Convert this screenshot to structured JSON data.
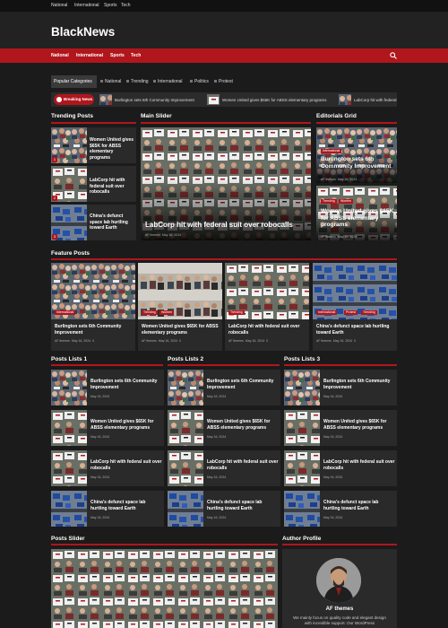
{
  "topbar": [
    "National",
    "International",
    "Sports",
    "Tech"
  ],
  "logo": "BlackNews",
  "nav": [
    "National",
    "International",
    "Sports",
    "Tech"
  ],
  "popular": {
    "label": "Popular Categories",
    "items": [
      "National",
      "Trending",
      "International",
      "Politics",
      "Protest"
    ]
  },
  "ticker": {
    "label": "Breaking News",
    "items": [
      "Burlington sets 6th Community Improvement",
      "Women United gives $65K for ABSS elementary programs",
      "LabCorp hit with federal"
    ]
  },
  "sections": {
    "trending": "Trending Posts",
    "main_slider": "Main Slider",
    "editorials": "Editorials Grid",
    "feature": "Feature Posts",
    "list1": "Posts Lists 1",
    "list2": "Posts Lists 2",
    "list3": "Posts Lists 3",
    "slider": "Posts Slider",
    "author": "Author Profile"
  },
  "posts": [
    {
      "title": "Burlington sets 6th Community Improvement",
      "badges": [
        "International"
      ]
    },
    {
      "title": "Women United gives $65K for ABSS elementary programs",
      "badges": [
        "Trending",
        "Women"
      ]
    },
    {
      "title": "LabCorp hit with federal suit over robocalls",
      "badges": [
        "Trending"
      ]
    },
    {
      "title": "China's defunct space lab hurtling toward Earth",
      "badges": [
        "International",
        "Protest",
        "Trending"
      ]
    }
  ],
  "trending_posts": [
    {
      "num": "1",
      "title": "Women United gives $65K for ABSS elementary programs"
    },
    {
      "num": "2",
      "title": "LabCorp hit with federal suit over robocalls"
    },
    {
      "num": "3",
      "title": "China's defunct space lab hurtling toward Earth"
    }
  ],
  "main_slider": {
    "title": "LabCorp hit with federal suit over robocalls",
    "meta_author": "AF themes",
    "meta_date": "May 16, 2024"
  },
  "meta": {
    "author": "AF themes",
    "date": "May 16, 2024",
    "comments": "0"
  },
  "author": {
    "name": "AF themes",
    "bio": "We mainly focus on quality code and elegant design with incredible support. Our WordPress"
  },
  "icons": {
    "search": "search-icon",
    "clock": "clock-icon",
    "comment": "comment-icon"
  },
  "colors": {
    "accent": "#b0161c",
    "bg": "#1b1b1b",
    "card": "#2a2a2a"
  }
}
